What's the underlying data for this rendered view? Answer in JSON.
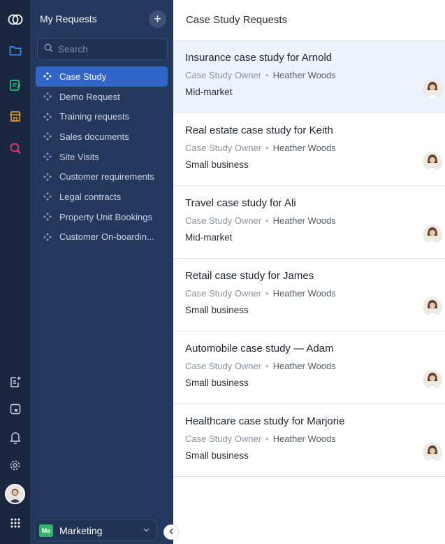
{
  "sidebar": {
    "title": "My Requests",
    "add_label": "+",
    "search_placeholder": "Search",
    "items": [
      {
        "label": "Case Study",
        "active": true
      },
      {
        "label": "Demo Request",
        "active": false
      },
      {
        "label": "Training requests",
        "active": false
      },
      {
        "label": "Sales documents",
        "active": false
      },
      {
        "label": "Site Visits",
        "active": false
      },
      {
        "label": "Customer requirements",
        "active": false
      },
      {
        "label": "Legal contracts",
        "active": false
      },
      {
        "label": "Property Unit Bookings",
        "active": false
      },
      {
        "label": "Customer On-boardin...",
        "active": false
      }
    ],
    "workspace": {
      "badge": "Ma",
      "name": "Marketing"
    }
  },
  "main": {
    "header": "Case Study Requests",
    "cards": [
      {
        "title": "Insurance case study for Arnold",
        "owner_label": "Case Study Owner",
        "owner": "Heather Woods",
        "segment": "Mid-market",
        "selected": true
      },
      {
        "title": "Real estate case study for Keith",
        "owner_label": "Case Study Owner",
        "owner": "Heather Woods",
        "segment": "Small business",
        "selected": false
      },
      {
        "title": "Travel case study for Ali",
        "owner_label": "Case Study Owner",
        "owner": "Heather Woods",
        "segment": "Mid-market",
        "selected": false
      },
      {
        "title": "Retail case study for James",
        "owner_label": "Case Study Owner",
        "owner": "Heather Woods",
        "segment": "Small business",
        "selected": false
      },
      {
        "title": "Automobile case study — Adam",
        "owner_label": "Case Study Owner",
        "owner": "Heather Woods",
        "segment": "Small business",
        "selected": false
      },
      {
        "title": "Healthcare case study for Marjorie",
        "owner_label": "Case Study Owner",
        "owner": "Heather Woods",
        "segment": "Small business",
        "selected": false
      }
    ]
  },
  "colors": {
    "rail": "#1b2740",
    "sidebar": "#24375c",
    "active_item": "#2f65c6",
    "selected_card": "#eef2fb",
    "workspace_badge": "#2fb56a"
  },
  "icons": {
    "rail_top": [
      "app-logo-icon",
      "folder-icon",
      "requests-icon",
      "store-icon",
      "search-analytics-icon"
    ],
    "rail_bottom": [
      "add-task-icon",
      "calendar-icon",
      "bell-icon",
      "settings-icon",
      "user-avatar",
      "apps-grid-icon"
    ],
    "item": "workflow-diamond-icon"
  }
}
